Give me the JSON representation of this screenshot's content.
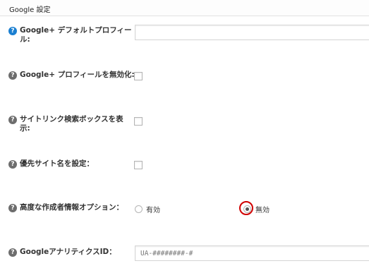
{
  "section": {
    "title": "Google 設定"
  },
  "fields": {
    "default_profile": {
      "label": "Google+ デフォルトプロフィール:",
      "value": "",
      "help": "?"
    },
    "disable_profile": {
      "label": "Google+ プロフィールを無効化:",
      "checked": false,
      "help": "?"
    },
    "sitelinks_search": {
      "label": "サイトリンク検索ボックスを表示:",
      "checked": false,
      "help": "?"
    },
    "preferred_site_name": {
      "label": "優先サイト名を設定：",
      "checked": false,
      "help": "?"
    },
    "advanced_author": {
      "label": "高度な作成者情報オプション：",
      "help": "?",
      "options": [
        {
          "label": "有効",
          "selected": false
        },
        {
          "label": "無効",
          "selected": true
        }
      ]
    },
    "analytics_id": {
      "label": "GoogleアナリティクスID：",
      "placeholder": "UA-########-#",
      "help": "?"
    }
  },
  "colors": {
    "highlight": "#d00000",
    "help_active": "#1a7fd1",
    "help_default": "#6d6d6d"
  }
}
